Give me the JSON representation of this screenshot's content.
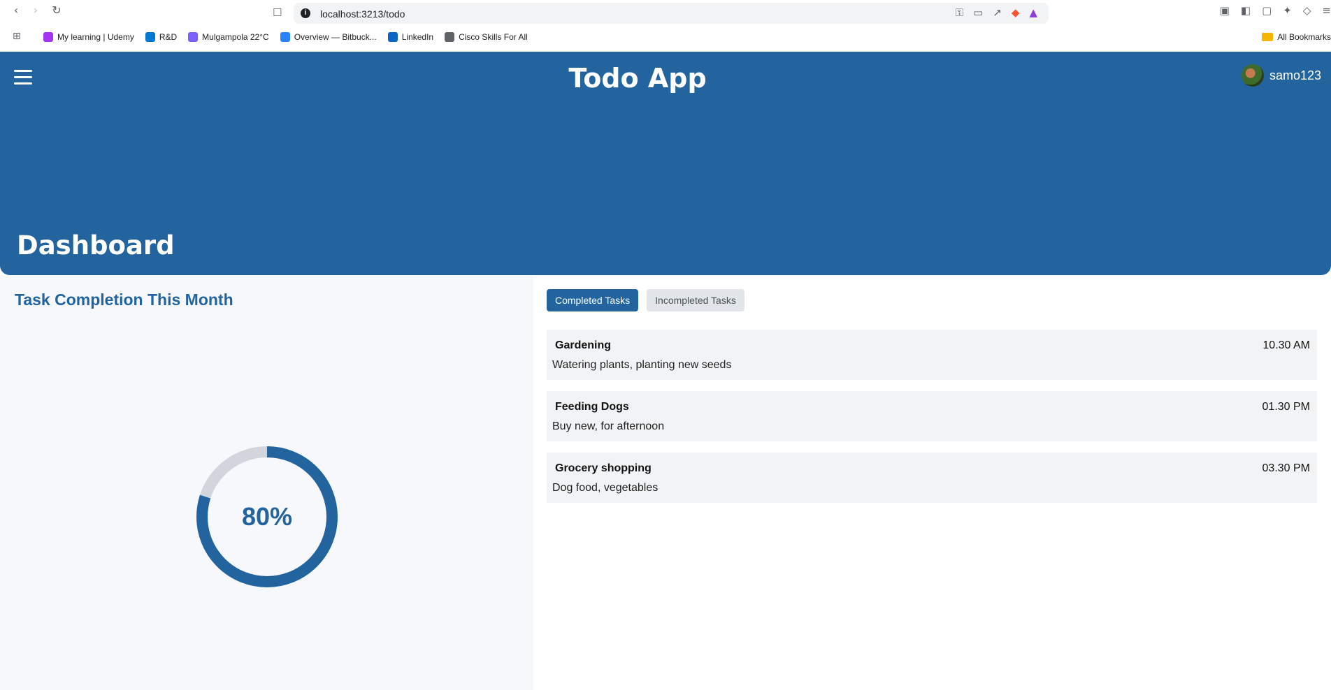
{
  "browser": {
    "url": "localhost:3213/todo",
    "bookmarks": [
      {
        "label": "My learning | Udemy",
        "color": "#a435f0"
      },
      {
        "label": "R&D",
        "color": "#0078d4"
      },
      {
        "label": "Mulgampola 22°C",
        "color": "#7b61ff"
      },
      {
        "label": "Overview — Bitbuck...",
        "color": "#2684ff"
      },
      {
        "label": "LinkedIn",
        "color": "#0a66c2"
      },
      {
        "label": "Cisco Skills For All",
        "color": "#5f6368"
      }
    ],
    "all_bookmarks": "All Bookmarks"
  },
  "header": {
    "title": "Todo App",
    "username": "samo123",
    "page_title": "Dashboard",
    "color": "#23649e"
  },
  "completion": {
    "title": "Task Completion This Month",
    "percent_label": "80%",
    "percent": 80,
    "track_color": "#d2d6dc",
    "fill_color": "#23649e"
  },
  "tabs": {
    "completed": "Completed Tasks",
    "incompleted": "Incompleted Tasks"
  },
  "tasks": [
    {
      "name": "Gardening",
      "time": "10.30 AM",
      "description": "Watering plants, planting new seeds"
    },
    {
      "name": "Feeding Dogs",
      "time": "01.30 PM",
      "description": "Buy new, for afternoon"
    },
    {
      "name": "Grocery shopping",
      "time": "03.30 PM",
      "description": "Dog food, vegetables"
    }
  ]
}
